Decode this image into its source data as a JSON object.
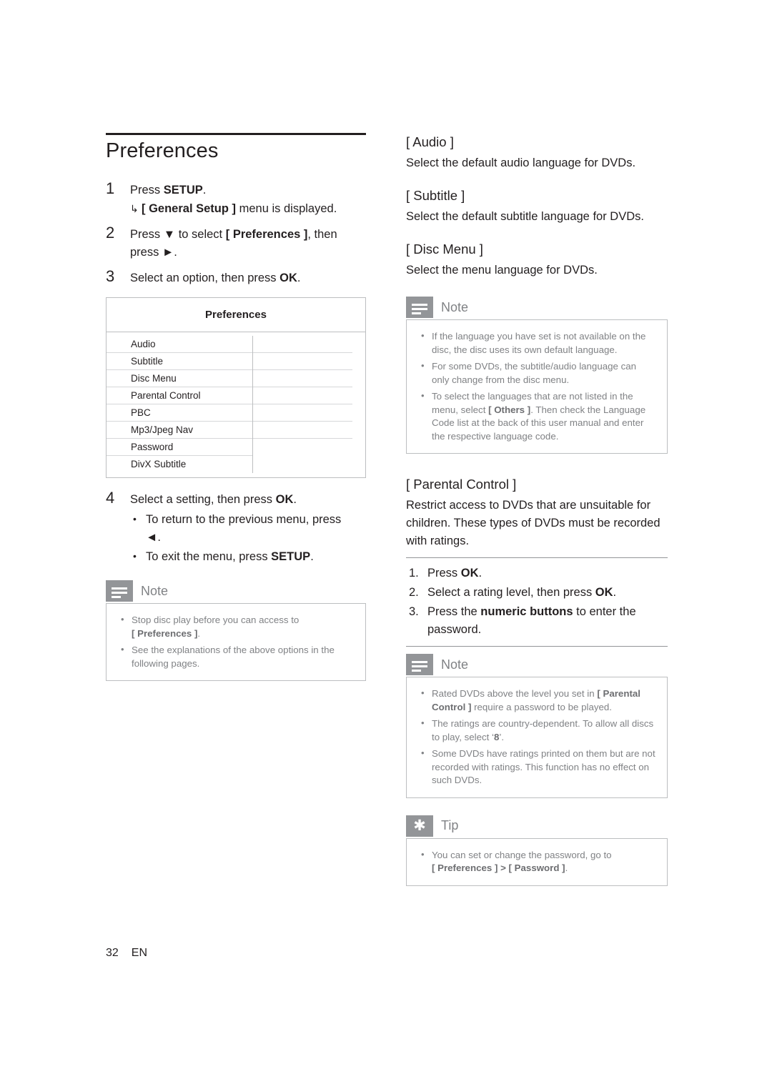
{
  "page": {
    "title": "Preferences",
    "footer_page_number": "32",
    "footer_language": "EN"
  },
  "steps": [
    {
      "num": "1",
      "text_before": "Press ",
      "bold": "SETUP",
      "text_after": ".",
      "sub": "[ General Setup ] menu is displayed.",
      "sub_bold": "[ General Setup ]",
      "sub_rest": " menu is displayed."
    },
    {
      "num": "2",
      "line1_a": "Press ",
      "line1_b": " to select ",
      "line1_c": "[ Preferences ]",
      "line1_d": ", then",
      "line2_a": "press ",
      "line2_b": "."
    },
    {
      "num": "3",
      "text_a": "Select an option, then press ",
      "bold": "OK",
      "text_b": "."
    },
    {
      "num": "4",
      "text_a": "Select a setting, then press ",
      "bold": "OK",
      "text_b": "."
    }
  ],
  "osd": {
    "header": "Preferences",
    "rows": [
      "Audio",
      "Subtitle",
      "Disc Menu",
      "Parental Control",
      "PBC",
      "Mp3/Jpeg Nav",
      "Password",
      "DivX Subtitle"
    ]
  },
  "step4_bullets": [
    {
      "a": "To return to the previous menu, press",
      "b": "◄",
      "c": "."
    },
    {
      "a": "To exit the menu, press ",
      "bold": "SETUP",
      "c": "."
    }
  ],
  "note_left": {
    "label": "Note",
    "items": [
      {
        "a": "Stop disc play before you can access to ",
        "bold": "[ Preferences ]",
        "c": "."
      },
      {
        "a": "See the explanations of the above options in the following pages."
      }
    ]
  },
  "right": {
    "audio": {
      "heading": "[ Audio ]",
      "body": "Select the default audio language for DVDs."
    },
    "subtitle": {
      "heading": "[ Subtitle ]",
      "body": "Select the default subtitle language for DVDs."
    },
    "disc_menu": {
      "heading": "[ Disc Menu ]",
      "body": "Select the menu language for DVDs."
    },
    "note_top": {
      "label": "Note",
      "items": [
        "If the language you have set is not available on the disc, the disc uses its own default language.",
        "For some DVDs, the subtitle/audio language can only change from the disc menu.",
        {
          "a": "To select the languages that are not listed in the menu, select ",
          "bold": "[ Others ]",
          "c": ". Then check the Language Code list at the back of this user manual and enter the respective language code."
        }
      ]
    },
    "parental": {
      "heading": "[ Parental Control ]",
      "body": "Restrict access to DVDs that are unsuitable for children. These types of DVDs must be recorded with ratings.",
      "steps": [
        {
          "num": "1.",
          "a": "Press ",
          "bold": "OK",
          "c": "."
        },
        {
          "num": "2.",
          "a": "Select a rating level, then press ",
          "bold": "OK",
          "c": "."
        },
        {
          "num": "3.",
          "a": "Press the ",
          "bold": "numeric buttons",
          "c": " to enter the password."
        }
      ]
    },
    "note_bottom": {
      "label": "Note",
      "items": [
        {
          "a": "Rated DVDs above the level you set in ",
          "bold": "[ Parental Control ]",
          "c": " require a password to be played."
        },
        {
          "a": "The ratings are country-dependent. To allow all discs to play, select ‘",
          "bold": "8",
          "c": "’."
        },
        {
          "a": "Some DVDs have ratings printed on them but are not recorded with ratings.  This function has no effect on such DVDs."
        }
      ]
    },
    "tip": {
      "label": "Tip",
      "items": [
        {
          "a": "You can set or change the password, go to ",
          "bold": "[ Preferences ] > [ Password ]",
          "c": "."
        }
      ]
    }
  },
  "icons": {
    "note": "note-lines-icon",
    "tip": "tip-star-icon",
    "down_arrow": "▼",
    "right_arrow": "►",
    "left_arrow": "◄",
    "sub_arrow": "↳"
  }
}
